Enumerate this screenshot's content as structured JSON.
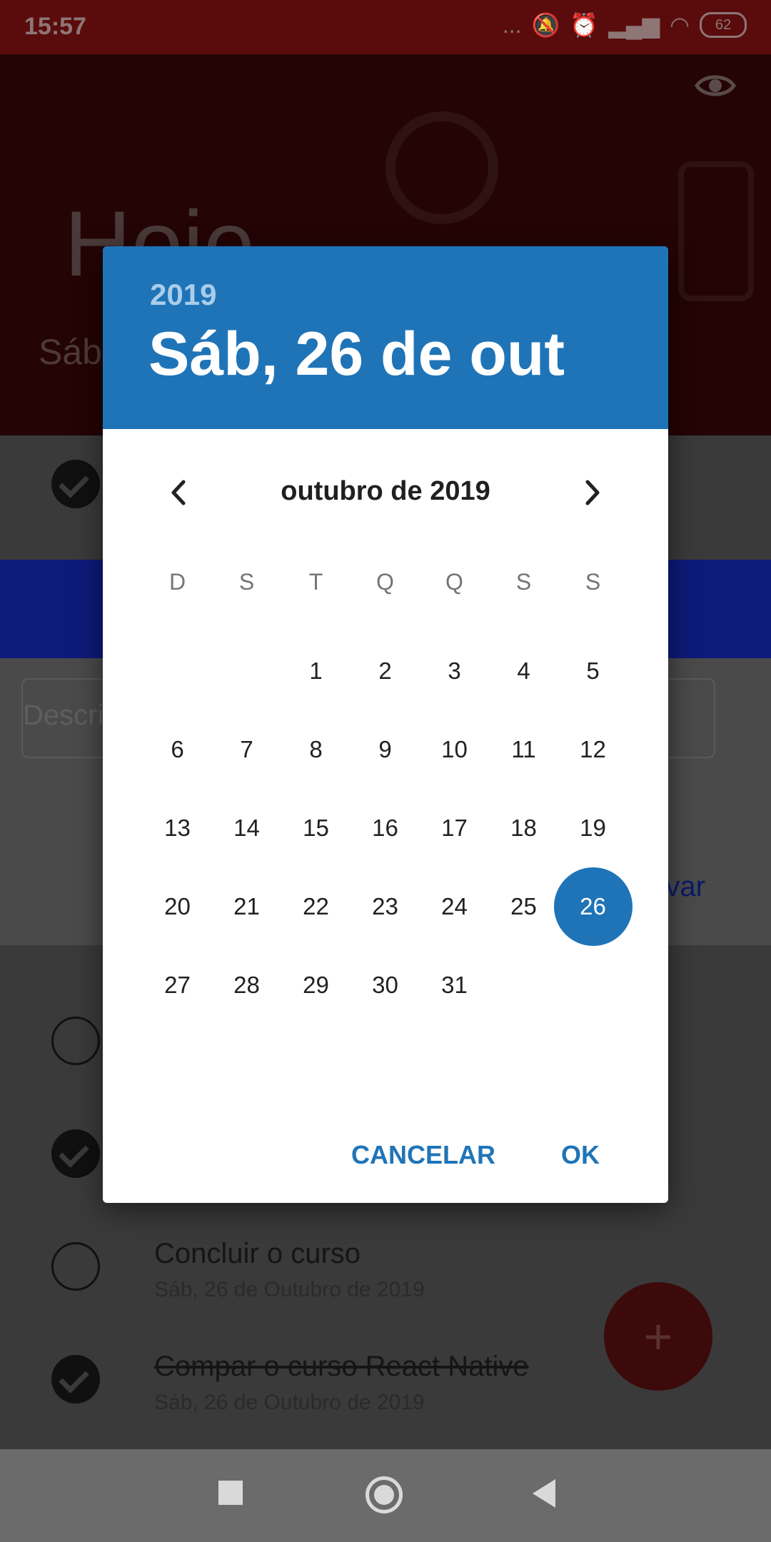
{
  "status_bar": {
    "time": "15:57",
    "dots": "...",
    "battery": "62"
  },
  "header": {
    "greeting": "Hoje",
    "subtitle": "Sáb"
  },
  "input": {
    "placeholder": "Descri",
    "save_label": "var"
  },
  "tasks": [
    {
      "title": "Concluir o curso",
      "date": "Sáb, 26 de Outubro de 2019",
      "done": false
    },
    {
      "title": "Compar o curso React Native",
      "date": "Sáb, 26 de Outubro de 2019",
      "done": true
    }
  ],
  "fab_label": "+",
  "dialog": {
    "year": "2019",
    "selected_date": "Sáb, 26 de out",
    "month_label": "outubro de 2019",
    "weekdays": [
      "D",
      "S",
      "T",
      "Q",
      "Q",
      "S",
      "S"
    ],
    "weeks": [
      [
        "",
        "",
        "1",
        "2",
        "3",
        "4",
        "5"
      ],
      [
        "6",
        "7",
        "8",
        "9",
        "10",
        "11",
        "12"
      ],
      [
        "13",
        "14",
        "15",
        "16",
        "17",
        "18",
        "19"
      ],
      [
        "20",
        "21",
        "22",
        "23",
        "24",
        "25",
        "26"
      ],
      [
        "27",
        "28",
        "29",
        "30",
        "31",
        "",
        ""
      ]
    ],
    "selected_day": "26",
    "cancel_label": "CANCELAR",
    "ok_label": "OK"
  },
  "colors": {
    "accent": "#1f74b7",
    "header_bg": "#240404"
  }
}
